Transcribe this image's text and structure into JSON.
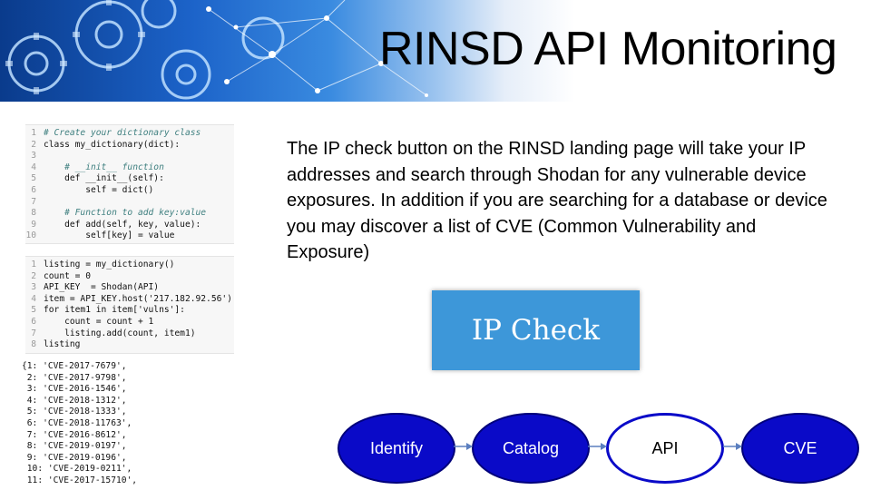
{
  "slide": {
    "title": "RINSD API Monitoring",
    "description": "The IP check button on the RINSD landing page will take your IP addresses and search through Shodan for any vulnerable device exposures. In addition if you are searching for a database or device you may discover a list of CVE (Common Vulnerability and Exposure)"
  },
  "code_cell_1": [
    {
      "n": "1",
      "text": "# Create your dictionary class"
    },
    {
      "n": "2",
      "text": "class my_dictionary(dict):"
    },
    {
      "n": "3",
      "text": ""
    },
    {
      "n": "4",
      "text": "    # __init__ function"
    },
    {
      "n": "5",
      "text": "    def __init__(self):"
    },
    {
      "n": "6",
      "text": "        self = dict()"
    },
    {
      "n": "7",
      "text": ""
    },
    {
      "n": "8",
      "text": "    # Function to add key:value"
    },
    {
      "n": "9",
      "text": "    def add(self, key, value):"
    },
    {
      "n": "10",
      "text": "        self[key] = value"
    }
  ],
  "code_cell_2": [
    {
      "n": "1",
      "text": "listing = my_dictionary()"
    },
    {
      "n": "2",
      "text": "count = 0"
    },
    {
      "n": "3",
      "text": "API_KEY  = Shodan(API)"
    },
    {
      "n": "4",
      "text": "item = API_KEY.host('217.182.92.56')"
    },
    {
      "n": "5",
      "text": "for item1 in item['vulns']:"
    },
    {
      "n": "6",
      "text": "    count = count + 1"
    },
    {
      "n": "7",
      "text": "    listing.add(count, item1)"
    },
    {
      "n": "8",
      "text": "listing"
    }
  ],
  "output_lines": [
    "{1: 'CVE-2017-7679',",
    " 2: 'CVE-2017-9798',",
    " 3: 'CVE-2016-1546',",
    " 4: 'CVE-2018-1312',",
    " 5: 'CVE-2018-1333',",
    " 6: 'CVE-2018-11763',",
    " 7: 'CVE-2016-8612',",
    " 8: 'CVE-2019-0197',",
    " 9: 'CVE-2019-0196',",
    " 10: 'CVE-2019-0211',",
    " 11: 'CVE-2017-15710',"
  ],
  "ip_check_button": {
    "label": "IP Check",
    "color": "#3d97d9"
  },
  "flow": [
    {
      "label": "Identify",
      "style": "filled"
    },
    {
      "label": "Catalog",
      "style": "filled"
    },
    {
      "label": "API",
      "style": "outline"
    },
    {
      "label": "CVE",
      "style": "filled"
    }
  ],
  "colors": {
    "flow_fill": "#0a0ac8",
    "banner_blue": "#1c63c9"
  }
}
